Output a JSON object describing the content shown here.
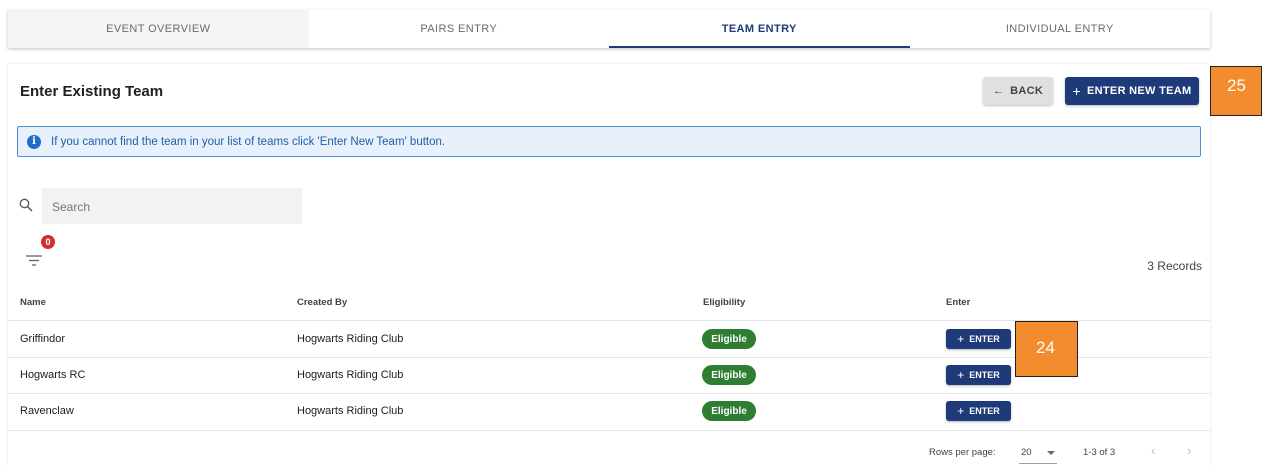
{
  "tabs": [
    {
      "label": "EVENT OVERVIEW"
    },
    {
      "label": "PAIRS ENTRY"
    },
    {
      "label": "TEAM ENTRY",
      "active": true
    },
    {
      "label": "INDIVIDUAL ENTRY"
    }
  ],
  "header": {
    "title": "Enter Existing Team",
    "back_label": "BACK",
    "back_icon": "arrow-left-icon",
    "new_team_label": "ENTER NEW TEAM",
    "new_team_icon": "plus-icon"
  },
  "annotations": {
    "badge_top": "25",
    "badge_row": "24"
  },
  "info": {
    "text": "If you cannot find the team in your list of teams click 'Enter New Team' button.",
    "icon": "info-icon"
  },
  "search": {
    "placeholder": "Search",
    "icon": "search-icon"
  },
  "filter": {
    "count": "0",
    "icon": "filter-icon"
  },
  "records": "3 Records",
  "table": {
    "columns": [
      "Name",
      "Created By",
      "Eligibility",
      "Enter"
    ],
    "rows": [
      {
        "name": "Griffindor",
        "created_by": "Hogwarts Riding Club",
        "eligibility": "Eligible",
        "action": "ENTER"
      },
      {
        "name": "Hogwarts RC",
        "created_by": "Hogwarts Riding Club",
        "eligibility": "Eligible",
        "action": "ENTER"
      },
      {
        "name": "Ravenclaw",
        "created_by": "Hogwarts Riding Club",
        "eligibility": "Eligible",
        "action": "ENTER"
      }
    ]
  },
  "pagination": {
    "rows_label": "Rows per page:",
    "rows_value": "20",
    "range": "1-3 of 3",
    "prev": "‹",
    "next": "›"
  },
  "colors": {
    "primary": "#1e3a78",
    "eligible": "#2e7d32",
    "badge": "#d32f2f",
    "annotation": "#f28c2e",
    "info_bg": "#e8f1fb"
  }
}
